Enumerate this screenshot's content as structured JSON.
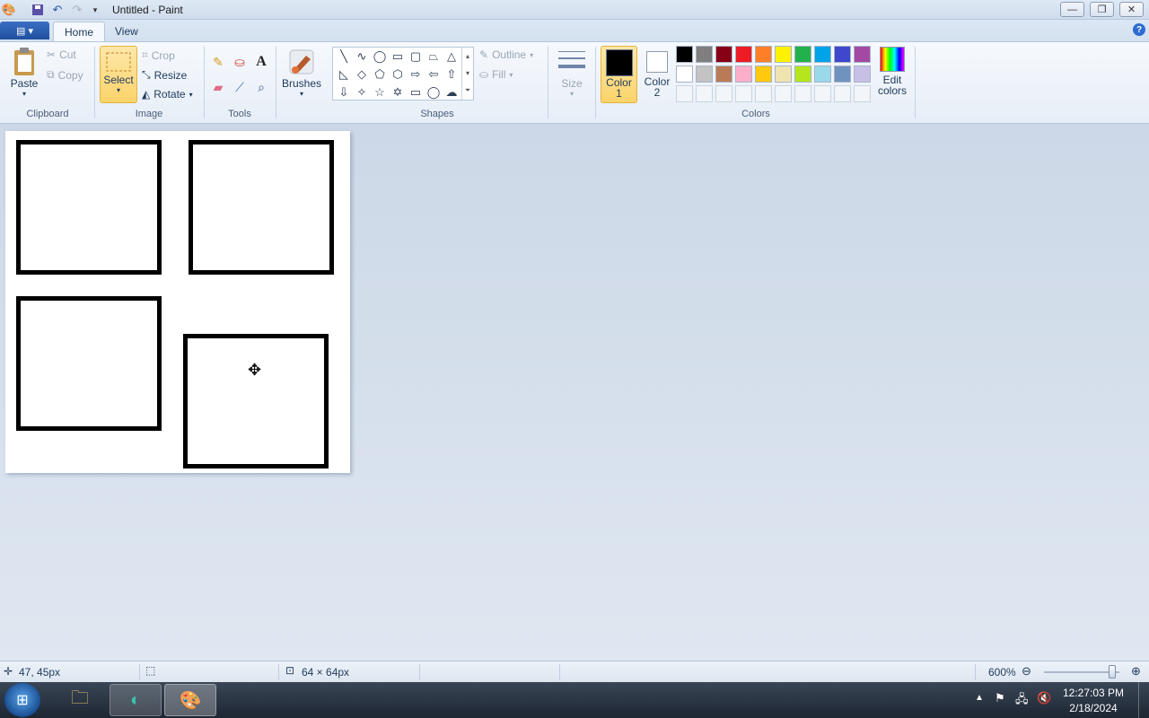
{
  "window": {
    "title": "Untitled - Paint",
    "controls": {
      "minimize": "—",
      "restore": "❐",
      "close": "✕"
    }
  },
  "tabs": {
    "home": "Home",
    "view": "View"
  },
  "clipboard": {
    "paste": "Paste",
    "cut": "Cut",
    "copy": "Copy",
    "group": "Clipboard"
  },
  "image": {
    "select": "Select",
    "crop": "Crop",
    "resize": "Resize",
    "rotate": "Rotate",
    "group": "Image"
  },
  "tools": {
    "group": "Tools"
  },
  "brushes": {
    "label": "Brushes"
  },
  "shapes": {
    "outline": "Outline",
    "fill": "Fill",
    "group": "Shapes"
  },
  "size": {
    "label": "Size"
  },
  "colors": {
    "color1_line1": "Color",
    "color1_line2": "1",
    "color2_line1": "Color",
    "color2_line2": "2",
    "edit_line1": "Edit",
    "edit_line2": "colors",
    "group": "Colors",
    "color1_value": "#000000",
    "color2_value": "#ffffff",
    "palette_row1": [
      "#000000",
      "#7f7f7f",
      "#880015",
      "#ed1c24",
      "#ff7f27",
      "#fff200",
      "#22b14c",
      "#00a2e8",
      "#3f48cc",
      "#a349a4"
    ],
    "palette_row2": [
      "#ffffff",
      "#c3c3c3",
      "#b97a57",
      "#ffaec9",
      "#ffc90e",
      "#efe4b0",
      "#b5e61d",
      "#99d9ea",
      "#7092be",
      "#c8bfe7"
    ]
  },
  "status": {
    "cursor_pos": "47, 45px",
    "selection_size": "64 × 64px",
    "zoom": "600%",
    "zoom_fraction": 0.9
  },
  "taskbar": {
    "time": "12:27:03 PM",
    "date": "2/18/2024"
  }
}
